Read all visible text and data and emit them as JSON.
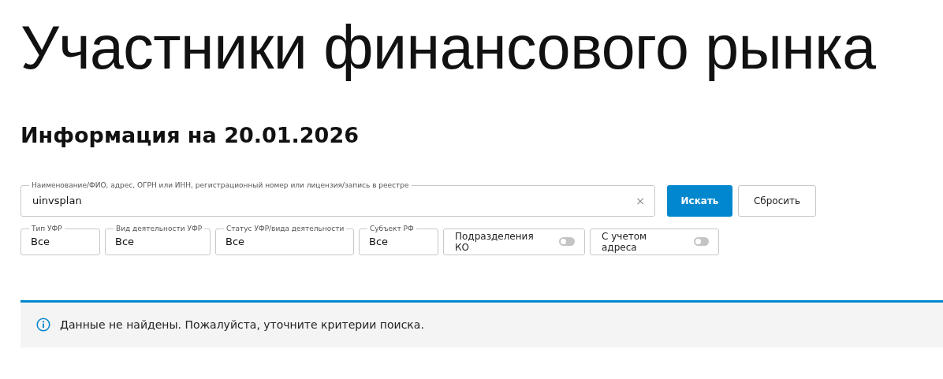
{
  "title": "Участники финансового рынка",
  "subtitle": "Информация на 20.01.2026",
  "search": {
    "label": "Наименование/ФИО, адрес, ОГРН или ИНН, регистрационный номер или лицензия/запись в реестре",
    "value": "uinvsplan",
    "clear": "×"
  },
  "buttons": [
    {
      "label": "Искать",
      "kind": "primary"
    },
    {
      "label": "Сбросить",
      "kind": "secondary"
    }
  ],
  "filters": [
    {
      "kind": "select",
      "label": "Тип УФР",
      "value": "Все"
    },
    {
      "kind": "select",
      "label": "Вид деятельности УФР",
      "value": "Все"
    },
    {
      "kind": "select",
      "label": "Статус УФР/вида деятельности",
      "value": "Все"
    },
    {
      "kind": "select",
      "label": "Субъект РФ",
      "value": "Все"
    },
    {
      "kind": "toggle",
      "label": "Подразделения КО",
      "on": false
    },
    {
      "kind": "toggle",
      "label": "С учетом адреса",
      "on": false
    }
  ],
  "notice": {
    "text": "Данные не найдены. Пожалуйста, уточните критерии поиска."
  }
}
